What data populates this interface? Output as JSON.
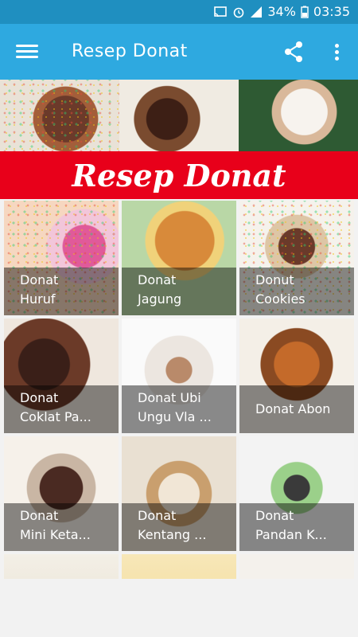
{
  "status_bar": {
    "battery_percent": "34%",
    "time": "03:35",
    "icons": [
      "cast-icon",
      "alarm-icon",
      "signal-icon",
      "battery-icon"
    ]
  },
  "app_bar": {
    "title": "Resep Donat",
    "icons": [
      "menu-icon",
      "share-icon",
      "more-vert-icon"
    ],
    "color": "#2ea9e0"
  },
  "banner": {
    "label": "Resep Donat",
    "color": "#e8001a"
  },
  "recipes": [
    {
      "title": "Donat\nHuruf"
    },
    {
      "title": "Donat\nJagung"
    },
    {
      "title": "Donut\nCookies"
    },
    {
      "title": "Donat\nCoklat Pa..."
    },
    {
      "title": "Donat Ubi\nUngu Vla ..."
    },
    {
      "title": "Donat Abon"
    },
    {
      "title": "Donat\nMini Keta..."
    },
    {
      "title": "Donat\nKentang ..."
    },
    {
      "title": "Donat\nPandan K..."
    },
    {
      "title": ""
    },
    {
      "title": ""
    },
    {
      "title": ""
    }
  ]
}
